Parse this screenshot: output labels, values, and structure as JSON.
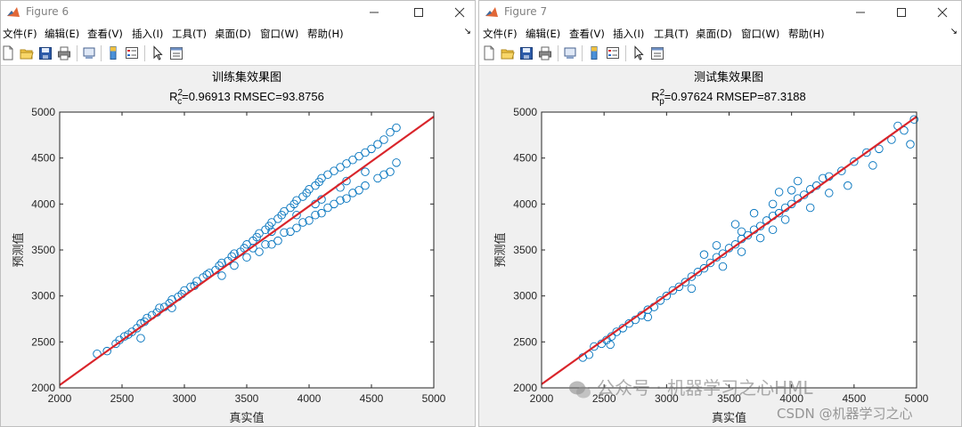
{
  "windows": [
    {
      "title": "Figure 6",
      "menu": [
        "文件(F)",
        "编辑(E)",
        "查看(V)",
        "插入(I)",
        "工具(T)",
        "桌面(D)",
        "窗口(W)",
        "帮助(H)"
      ],
      "plot_title": "训练集效果图",
      "metric_label": "R",
      "metric_sup": "2",
      "metric_sub": "c",
      "metric_value": "=0.96913  RMSEC=93.8756"
    },
    {
      "title": "Figure 7",
      "menu": [
        "文件(F)",
        "编辑(E)",
        "查看(V)",
        "插入(I)",
        "工具(T)",
        "桌面(D)",
        "窗口(W)",
        "帮助(H)"
      ],
      "plot_title": "测试集效果图",
      "metric_label": "R",
      "metric_sup": "2",
      "metric_sub": "p",
      "metric_value": "=0.97624  RMSEP=87.3188"
    }
  ],
  "watermark": {
    "wechat": "公众号 · 机器学习之心HML",
    "csdn": "CSDN @机器学习之心"
  },
  "chart_data": [
    {
      "type": "scatter",
      "title": "训练集效果图",
      "subtitle": "R_c^2=0.96913  RMSEC=93.8756",
      "xlabel": "真实值",
      "ylabel": "预测值",
      "xlim": [
        2000,
        5000
      ],
      "ylim": [
        2000,
        5000
      ],
      "xticks": [
        "2000",
        "2500",
        "3000",
        "3500",
        "4000",
        "4500",
        "5000"
      ],
      "yticks": [
        "2000",
        "2500",
        "3000",
        "3500",
        "4000",
        "4500",
        "5000"
      ],
      "marker_color": "#0072BD",
      "line_color": "#D9252B",
      "fit_line": [
        [
          2000,
          2030
        ],
        [
          5000,
          4950
        ]
      ],
      "points": [
        [
          2300,
          2370
        ],
        [
          2380,
          2400
        ],
        [
          2450,
          2480
        ],
        [
          2480,
          2520
        ],
        [
          2520,
          2560
        ],
        [
          2550,
          2580
        ],
        [
          2580,
          2610
        ],
        [
          2620,
          2650
        ],
        [
          2650,
          2700
        ],
        [
          2680,
          2720
        ],
        [
          2700,
          2760
        ],
        [
          2740,
          2790
        ],
        [
          2780,
          2820
        ],
        [
          2800,
          2870
        ],
        [
          2840,
          2880
        ],
        [
          2880,
          2920
        ],
        [
          2900,
          2960
        ],
        [
          2950,
          2990
        ],
        [
          2980,
          3020
        ],
        [
          3000,
          3060
        ],
        [
          3050,
          3100
        ],
        [
          3080,
          3110
        ],
        [
          3100,
          3160
        ],
        [
          3150,
          3200
        ],
        [
          3180,
          3230
        ],
        [
          3200,
          3250
        ],
        [
          3250,
          3280
        ],
        [
          3280,
          3330
        ],
        [
          3300,
          3360
        ],
        [
          3350,
          3380
        ],
        [
          3380,
          3430
        ],
        [
          3400,
          3460
        ],
        [
          3450,
          3480
        ],
        [
          3480,
          3520
        ],
        [
          3500,
          3560
        ],
        [
          3550,
          3600
        ],
        [
          3580,
          3640
        ],
        [
          3600,
          3680
        ],
        [
          3650,
          3720
        ],
        [
          3680,
          3760
        ],
        [
          3700,
          3800
        ],
        [
          3750,
          3840
        ],
        [
          3780,
          3880
        ],
        [
          3800,
          3920
        ],
        [
          3850,
          3960
        ],
        [
          3880,
          4000
        ],
        [
          3900,
          4040
        ],
        [
          3950,
          4080
        ],
        [
          3980,
          4120
        ],
        [
          4000,
          4160
        ],
        [
          4050,
          4200
        ],
        [
          4080,
          4240
        ],
        [
          4100,
          4280
        ],
        [
          4150,
          4320
        ],
        [
          4200,
          4360
        ],
        [
          4250,
          4400
        ],
        [
          4300,
          4440
        ],
        [
          4350,
          4480
        ],
        [
          4400,
          4520
        ],
        [
          4450,
          4560
        ],
        [
          4500,
          4600
        ],
        [
          4550,
          4650
        ],
        [
          4600,
          4700
        ],
        [
          4650,
          4780
        ],
        [
          4700,
          4830
        ],
        [
          2650,
          2540
        ],
        [
          2900,
          2870
        ],
        [
          3300,
          3220
        ],
        [
          3500,
          3420
        ],
        [
          3700,
          3560
        ],
        [
          3850,
          3700
        ],
        [
          3950,
          3800
        ],
        [
          4050,
          3880
        ],
        [
          4150,
          3960
        ],
        [
          4250,
          4040
        ],
        [
          4350,
          4120
        ],
        [
          4450,
          4200
        ],
        [
          4550,
          4280
        ],
        [
          4600,
          4320
        ],
        [
          4700,
          4450
        ],
        [
          4650,
          4350
        ],
        [
          3600,
          3480
        ],
        [
          3750,
          3600
        ],
        [
          3900,
          3740
        ],
        [
          4000,
          3820
        ],
        [
          4100,
          3900
        ],
        [
          4200,
          4000
        ],
        [
          4300,
          4060
        ],
        [
          4400,
          4150
        ],
        [
          3400,
          3330
        ],
        [
          3650,
          3560
        ],
        [
          3800,
          3690
        ],
        [
          4050,
          4000
        ],
        [
          4250,
          4180
        ],
        [
          4450,
          4350
        ],
        [
          3550,
          3520
        ],
        [
          3700,
          3700
        ],
        [
          3900,
          3880
        ],
        [
          4100,
          4050
        ],
        [
          4300,
          4250
        ]
      ]
    },
    {
      "type": "scatter",
      "title": "测试集效果图",
      "subtitle": "R_p^2=0.97624  RMSEP=87.3188",
      "xlabel": "真实值",
      "ylabel": "预测值",
      "xlim": [
        2000,
        5000
      ],
      "ylim": [
        2000,
        5000
      ],
      "xticks": [
        "2000",
        "2500",
        "3000",
        "3500",
        "4000",
        "4500",
        "5000"
      ],
      "yticks": [
        "2000",
        "2500",
        "3000",
        "3500",
        "4000",
        "4500",
        "5000"
      ],
      "marker_color": "#0072BD",
      "line_color": "#D9252B",
      "fit_line": [
        [
          2000,
          2040
        ],
        [
          5000,
          4950
        ]
      ],
      "points": [
        [
          2330,
          2330
        ],
        [
          2380,
          2360
        ],
        [
          2420,
          2450
        ],
        [
          2480,
          2480
        ],
        [
          2520,
          2520
        ],
        [
          2560,
          2560
        ],
        [
          2600,
          2610
        ],
        [
          2650,
          2650
        ],
        [
          2700,
          2700
        ],
        [
          2750,
          2740
        ],
        [
          2800,
          2790
        ],
        [
          2850,
          2850
        ],
        [
          2900,
          2880
        ],
        [
          2950,
          2950
        ],
        [
          3000,
          3000
        ],
        [
          3050,
          3060
        ],
        [
          3100,
          3100
        ],
        [
          3150,
          3150
        ],
        [
          3200,
          3210
        ],
        [
          3250,
          3260
        ],
        [
          3300,
          3300
        ],
        [
          3350,
          3360
        ],
        [
          3400,
          3420
        ],
        [
          3450,
          3460
        ],
        [
          3500,
          3520
        ],
        [
          3550,
          3560
        ],
        [
          3600,
          3620
        ],
        [
          3650,
          3660
        ],
        [
          3700,
          3720
        ],
        [
          3750,
          3760
        ],
        [
          3800,
          3820
        ],
        [
          3850,
          3870
        ],
        [
          3900,
          3900
        ],
        [
          3950,
          3960
        ],
        [
          4000,
          4000
        ],
        [
          4050,
          4060
        ],
        [
          4100,
          4100
        ],
        [
          4150,
          4160
        ],
        [
          4200,
          4200
        ],
        [
          4300,
          4300
        ],
        [
          4400,
          4360
        ],
        [
          4500,
          4460
        ],
        [
          4600,
          4560
        ],
        [
          4700,
          4600
        ],
        [
          4800,
          4700
        ],
        [
          4850,
          4850
        ],
        [
          4900,
          4800
        ],
        [
          4950,
          4650
        ],
        [
          4980,
          4920
        ],
        [
          4650,
          4420
        ],
        [
          2550,
          2470
        ],
        [
          2850,
          2770
        ],
        [
          3200,
          3080
        ],
        [
          3450,
          3320
        ],
        [
          3600,
          3480
        ],
        [
          3750,
          3630
        ],
        [
          3850,
          3720
        ],
        [
          3950,
          3830
        ],
        [
          4150,
          3960
        ],
        [
          4300,
          4120
        ],
        [
          4450,
          4200
        ],
        [
          3550,
          3780
        ],
        [
          3700,
          3900
        ],
        [
          3900,
          4130
        ],
        [
          4050,
          4250
        ],
        [
          4250,
          4280
        ],
        [
          3300,
          3450
        ],
        [
          3400,
          3550
        ],
        [
          3600,
          3700
        ],
        [
          3850,
          4000
        ],
        [
          4000,
          4150
        ]
      ]
    }
  ]
}
